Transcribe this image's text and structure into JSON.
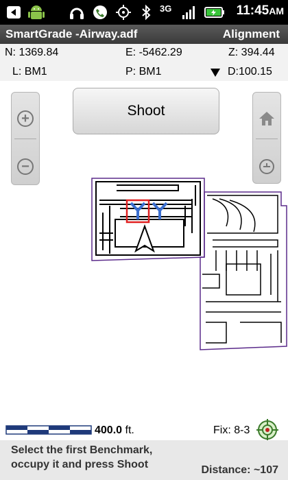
{
  "status_bar": {
    "time": "11:45",
    "time_suffix": "AM",
    "network": "3G",
    "icons": [
      "back-notification-icon",
      "android-icon",
      "headphones-icon",
      "phone-icon",
      "gps-icon",
      "bluetooth-icon",
      "signal-icon",
      "battery-icon"
    ]
  },
  "title_bar": {
    "title": "SmartGrade -Airway.adf",
    "mode": "Alignment"
  },
  "coords": {
    "n": "N: 1369.84",
    "e": "E: -5462.29",
    "z": "Z: 394.44",
    "l": "L:  BM1",
    "p": "P:  BM1",
    "d": "D:100.15"
  },
  "buttons": {
    "shoot": "Shoot"
  },
  "scale": {
    "value": "400.0",
    "unit": " ft."
  },
  "fix": "Fix: 8-3",
  "instruction": {
    "line1": "Select the first Benchmark,",
    "line2": "occupy it and press Shoot"
  },
  "distance": "Distance: ~107",
  "colors": {
    "accent_blue": "#3b6fd0",
    "marker_red": "#e02020",
    "status_green": "#3a7a2a",
    "title_bar": "#4a4a4a"
  }
}
